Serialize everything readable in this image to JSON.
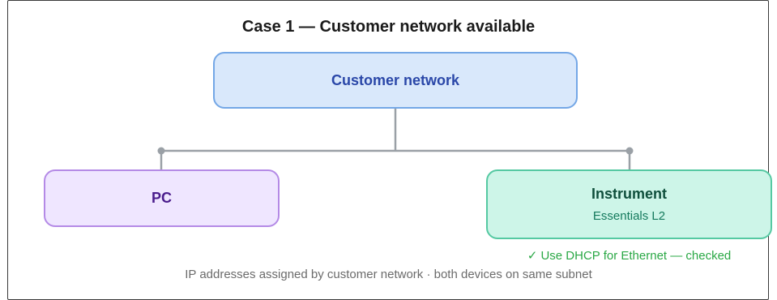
{
  "title": "Case 1 — Customer network available",
  "nodes": {
    "customer_network": {
      "label": "Customer network"
    },
    "pc": {
      "label": "PC"
    },
    "instrument": {
      "label": "Instrument",
      "sublabel": "Essentials L2"
    }
  },
  "notes": {
    "dhcp": "✓ Use DHCP for Ethernet — checked",
    "footer": "IP addresses assigned by customer network · both devices on same subnet"
  },
  "colors": {
    "customer_fill": "#d9e8fb",
    "customer_border": "#74a7e6",
    "pc_fill": "#efe6ff",
    "pc_border": "#b48ae6",
    "instrument_fill": "#cdf5e8",
    "instrument_border": "#55c9a2",
    "connector": "#9aa0a6",
    "dhcp_text": "#2aa845"
  }
}
